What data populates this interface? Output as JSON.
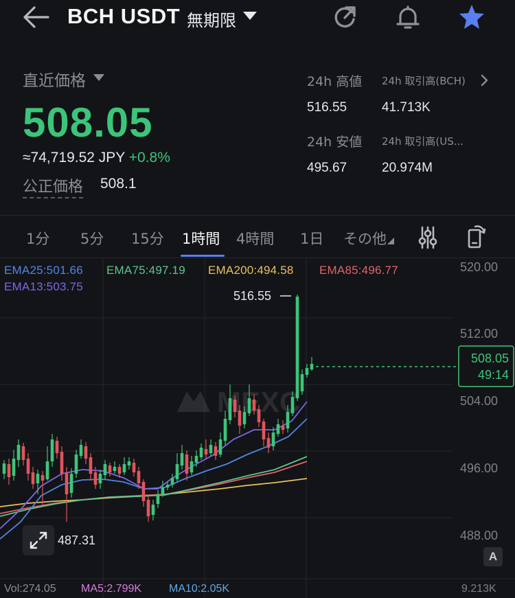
{
  "header": {
    "pair": "BCH USDT",
    "contract_type": "無期限",
    "icons": [
      "back-arrow-icon",
      "refresh-icon",
      "bell-icon",
      "star-icon"
    ]
  },
  "price": {
    "label": "直近価格",
    "last": "508.05",
    "jpy": "≈74,719.52 JPY",
    "change": "+0.8%",
    "fair_label": "公正価格",
    "fair_value": "508.1"
  },
  "stats": {
    "high_label": "24h 高値",
    "high_value": "516.55",
    "low_label": "24h 安値",
    "low_value": "495.67",
    "vol_bch_label": "24h 取引高(BCH)",
    "vol_bch_value": "41.713K",
    "vol_usdt_label": "24h 取引高(US...",
    "vol_usdt_value": "20.974M"
  },
  "tabs": [
    "1分",
    "5分",
    "15分",
    "1時間",
    "4時間",
    "1日",
    "その他"
  ],
  "active_tab": "1時間",
  "indicators": {
    "ema25": "EMA25:501.66",
    "ema75": "EMA75:497.19",
    "ema200": "EMA200:494.58",
    "ema85": "EMA85:496.77",
    "ema13": "EMA13:503.75"
  },
  "colors": {
    "up": "#3cc57a",
    "down": "#e0555e",
    "ema25": "#4f86e8",
    "ema75": "#5fc48f",
    "ema200": "#e8c25b",
    "ema85": "#e0646a",
    "ema13": "#7b68e8",
    "accent": "#5b7ff0"
  },
  "chart": {
    "price_axis": [
      "520.00",
      "512.00",
      "504.00",
      "496.00",
      "488.00"
    ],
    "current_price": "508.05",
    "countdown": "49:14",
    "high_marker": "516.55",
    "low_marker": "487.31",
    "auto_label": "A",
    "watermark": "MEXC",
    "volume_axis_top": "9.213K"
  },
  "volume": {
    "vol": "Vol:274.05",
    "ma5": "MA5:2.799K",
    "ma10": "MA10:2.05K"
  }
}
